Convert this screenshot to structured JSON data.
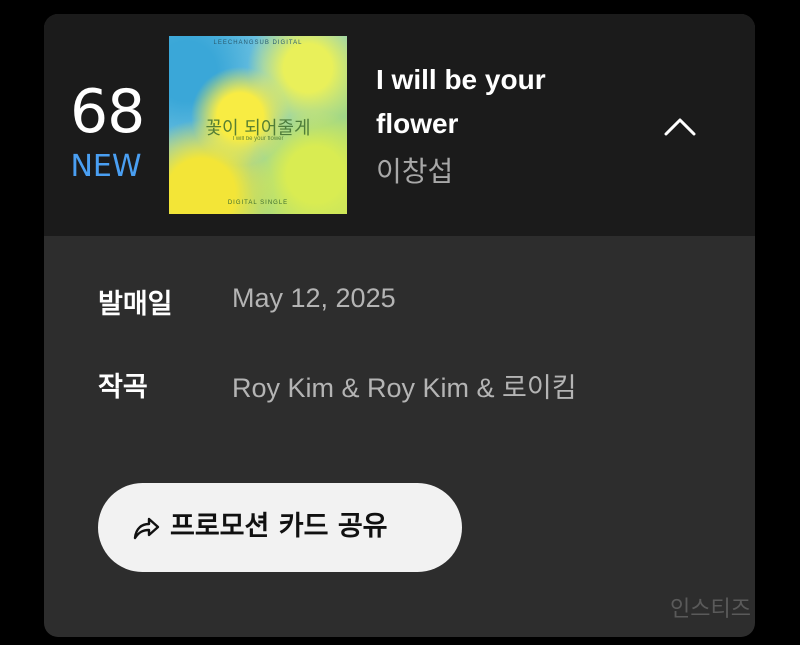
{
  "rank": {
    "number": "68",
    "badge": "NEW"
  },
  "song": {
    "title": "I will be your flower",
    "artist": "이창섭",
    "album_art": {
      "top_text": "LEECHANGSUB DIGITAL",
      "title_text": "꽃이 되어줄게",
      "subtitle_text": "I will be your flower",
      "bottom_text": "DIGITAL SINGLE"
    }
  },
  "details": {
    "release_label": "발매일",
    "release_value": "May 12, 2025",
    "composer_label": "작곡",
    "composer_value": "Roy Kim & Roy Kim & 로이킴"
  },
  "share_button": {
    "label": "프로모션 카드 공유",
    "icon": "share-arrow-icon"
  },
  "watermark": "인스티즈",
  "colors": {
    "background": "#000000",
    "card": "#2d2d2d",
    "header": "#1b1b1b",
    "new_badge": "#4a9ff2",
    "button": "#f2f2f2"
  }
}
